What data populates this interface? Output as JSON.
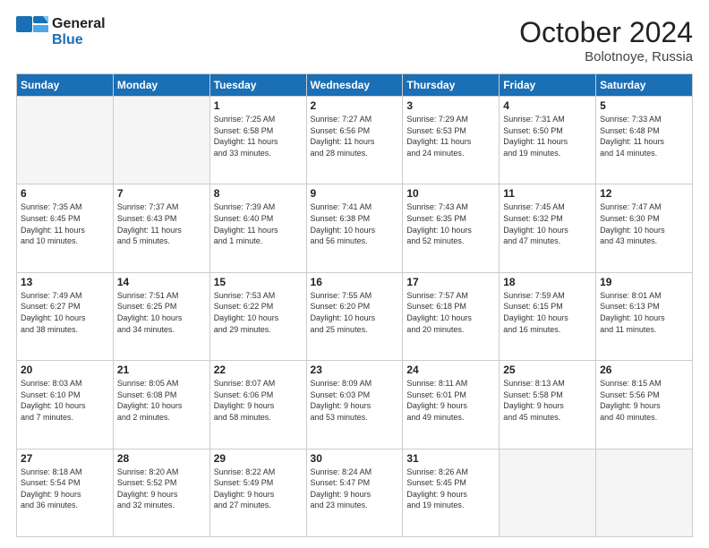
{
  "header": {
    "logo_line1": "General",
    "logo_line2": "Blue",
    "month": "October 2024",
    "location": "Bolotnoye, Russia"
  },
  "weekdays": [
    "Sunday",
    "Monday",
    "Tuesday",
    "Wednesday",
    "Thursday",
    "Friday",
    "Saturday"
  ],
  "weeks": [
    [
      {
        "day": "",
        "detail": ""
      },
      {
        "day": "",
        "detail": ""
      },
      {
        "day": "1",
        "detail": "Sunrise: 7:25 AM\nSunset: 6:58 PM\nDaylight: 11 hours\nand 33 minutes."
      },
      {
        "day": "2",
        "detail": "Sunrise: 7:27 AM\nSunset: 6:56 PM\nDaylight: 11 hours\nand 28 minutes."
      },
      {
        "day": "3",
        "detail": "Sunrise: 7:29 AM\nSunset: 6:53 PM\nDaylight: 11 hours\nand 24 minutes."
      },
      {
        "day": "4",
        "detail": "Sunrise: 7:31 AM\nSunset: 6:50 PM\nDaylight: 11 hours\nand 19 minutes."
      },
      {
        "day": "5",
        "detail": "Sunrise: 7:33 AM\nSunset: 6:48 PM\nDaylight: 11 hours\nand 14 minutes."
      }
    ],
    [
      {
        "day": "6",
        "detail": "Sunrise: 7:35 AM\nSunset: 6:45 PM\nDaylight: 11 hours\nand 10 minutes."
      },
      {
        "day": "7",
        "detail": "Sunrise: 7:37 AM\nSunset: 6:43 PM\nDaylight: 11 hours\nand 5 minutes."
      },
      {
        "day": "8",
        "detail": "Sunrise: 7:39 AM\nSunset: 6:40 PM\nDaylight: 11 hours\nand 1 minute."
      },
      {
        "day": "9",
        "detail": "Sunrise: 7:41 AM\nSunset: 6:38 PM\nDaylight: 10 hours\nand 56 minutes."
      },
      {
        "day": "10",
        "detail": "Sunrise: 7:43 AM\nSunset: 6:35 PM\nDaylight: 10 hours\nand 52 minutes."
      },
      {
        "day": "11",
        "detail": "Sunrise: 7:45 AM\nSunset: 6:32 PM\nDaylight: 10 hours\nand 47 minutes."
      },
      {
        "day": "12",
        "detail": "Sunrise: 7:47 AM\nSunset: 6:30 PM\nDaylight: 10 hours\nand 43 minutes."
      }
    ],
    [
      {
        "day": "13",
        "detail": "Sunrise: 7:49 AM\nSunset: 6:27 PM\nDaylight: 10 hours\nand 38 minutes."
      },
      {
        "day": "14",
        "detail": "Sunrise: 7:51 AM\nSunset: 6:25 PM\nDaylight: 10 hours\nand 34 minutes."
      },
      {
        "day": "15",
        "detail": "Sunrise: 7:53 AM\nSunset: 6:22 PM\nDaylight: 10 hours\nand 29 minutes."
      },
      {
        "day": "16",
        "detail": "Sunrise: 7:55 AM\nSunset: 6:20 PM\nDaylight: 10 hours\nand 25 minutes."
      },
      {
        "day": "17",
        "detail": "Sunrise: 7:57 AM\nSunset: 6:18 PM\nDaylight: 10 hours\nand 20 minutes."
      },
      {
        "day": "18",
        "detail": "Sunrise: 7:59 AM\nSunset: 6:15 PM\nDaylight: 10 hours\nand 16 minutes."
      },
      {
        "day": "19",
        "detail": "Sunrise: 8:01 AM\nSunset: 6:13 PM\nDaylight: 10 hours\nand 11 minutes."
      }
    ],
    [
      {
        "day": "20",
        "detail": "Sunrise: 8:03 AM\nSunset: 6:10 PM\nDaylight: 10 hours\nand 7 minutes."
      },
      {
        "day": "21",
        "detail": "Sunrise: 8:05 AM\nSunset: 6:08 PM\nDaylight: 10 hours\nand 2 minutes."
      },
      {
        "day": "22",
        "detail": "Sunrise: 8:07 AM\nSunset: 6:06 PM\nDaylight: 9 hours\nand 58 minutes."
      },
      {
        "day": "23",
        "detail": "Sunrise: 8:09 AM\nSunset: 6:03 PM\nDaylight: 9 hours\nand 53 minutes."
      },
      {
        "day": "24",
        "detail": "Sunrise: 8:11 AM\nSunset: 6:01 PM\nDaylight: 9 hours\nand 49 minutes."
      },
      {
        "day": "25",
        "detail": "Sunrise: 8:13 AM\nSunset: 5:58 PM\nDaylight: 9 hours\nand 45 minutes."
      },
      {
        "day": "26",
        "detail": "Sunrise: 8:15 AM\nSunset: 5:56 PM\nDaylight: 9 hours\nand 40 minutes."
      }
    ],
    [
      {
        "day": "27",
        "detail": "Sunrise: 8:18 AM\nSunset: 5:54 PM\nDaylight: 9 hours\nand 36 minutes."
      },
      {
        "day": "28",
        "detail": "Sunrise: 8:20 AM\nSunset: 5:52 PM\nDaylight: 9 hours\nand 32 minutes."
      },
      {
        "day": "29",
        "detail": "Sunrise: 8:22 AM\nSunset: 5:49 PM\nDaylight: 9 hours\nand 27 minutes."
      },
      {
        "day": "30",
        "detail": "Sunrise: 8:24 AM\nSunset: 5:47 PM\nDaylight: 9 hours\nand 23 minutes."
      },
      {
        "day": "31",
        "detail": "Sunrise: 8:26 AM\nSunset: 5:45 PM\nDaylight: 9 hours\nand 19 minutes."
      },
      {
        "day": "",
        "detail": ""
      },
      {
        "day": "",
        "detail": ""
      }
    ]
  ]
}
